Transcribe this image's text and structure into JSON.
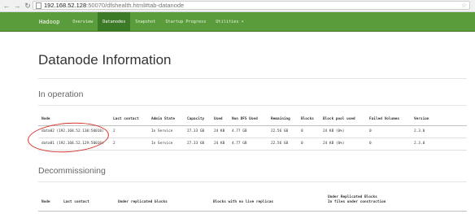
{
  "browser": {
    "back_icon": "back-arrow-icon",
    "forward_icon": "forward-arrow-icon",
    "reload_icon": "reload-icon",
    "url_host": "192.168.52.128",
    "url_path": ":50070/dfshealth.html#tab-datanode",
    "bookmark_icon": "star-icon"
  },
  "navbar": {
    "brand": "Hadoop",
    "items": [
      {
        "label": "Overview",
        "active": false
      },
      {
        "label": "Datanodes",
        "active": true
      },
      {
        "label": "Snapshot",
        "active": false
      },
      {
        "label": "Startup Progress",
        "active": false
      },
      {
        "label": "Utilities ▾",
        "active": false
      }
    ],
    "color": "#5a9b3c"
  },
  "page": {
    "title": "Datanode Information"
  },
  "in_operation": {
    "heading": "In operation",
    "columns": [
      "Node",
      "Last contact",
      "Admin State",
      "Capacity",
      "Used",
      "Non DFS Used",
      "Remaining",
      "Blocks",
      "Block pool used",
      "Failed Volumes",
      "Version"
    ],
    "rows": [
      [
        "data02 (192.168.52.130:50010)",
        "2",
        "In Service",
        "27.33 GB",
        "24 KB",
        "4.77 GB",
        "22.56 GB",
        "0",
        "24 KB (0%)",
        "0",
        "2.3.0"
      ],
      [
        "data01 (192.168.52.129:50010)",
        "2",
        "In Service",
        "27.33 GB",
        "24 KB",
        "4.77 GB",
        "22.56 GB",
        "0",
        "24 KB (0%)",
        "0",
        "2.3.0"
      ]
    ]
  },
  "decommissioning": {
    "heading": "Decommissioning",
    "columns": [
      "Node",
      "Last contact",
      "Under replicated blocks",
      "Blocks with no live replicas",
      "Under Replicated Blocks",
      "In files under construction"
    ]
  },
  "annotation_color": "#d9342b"
}
